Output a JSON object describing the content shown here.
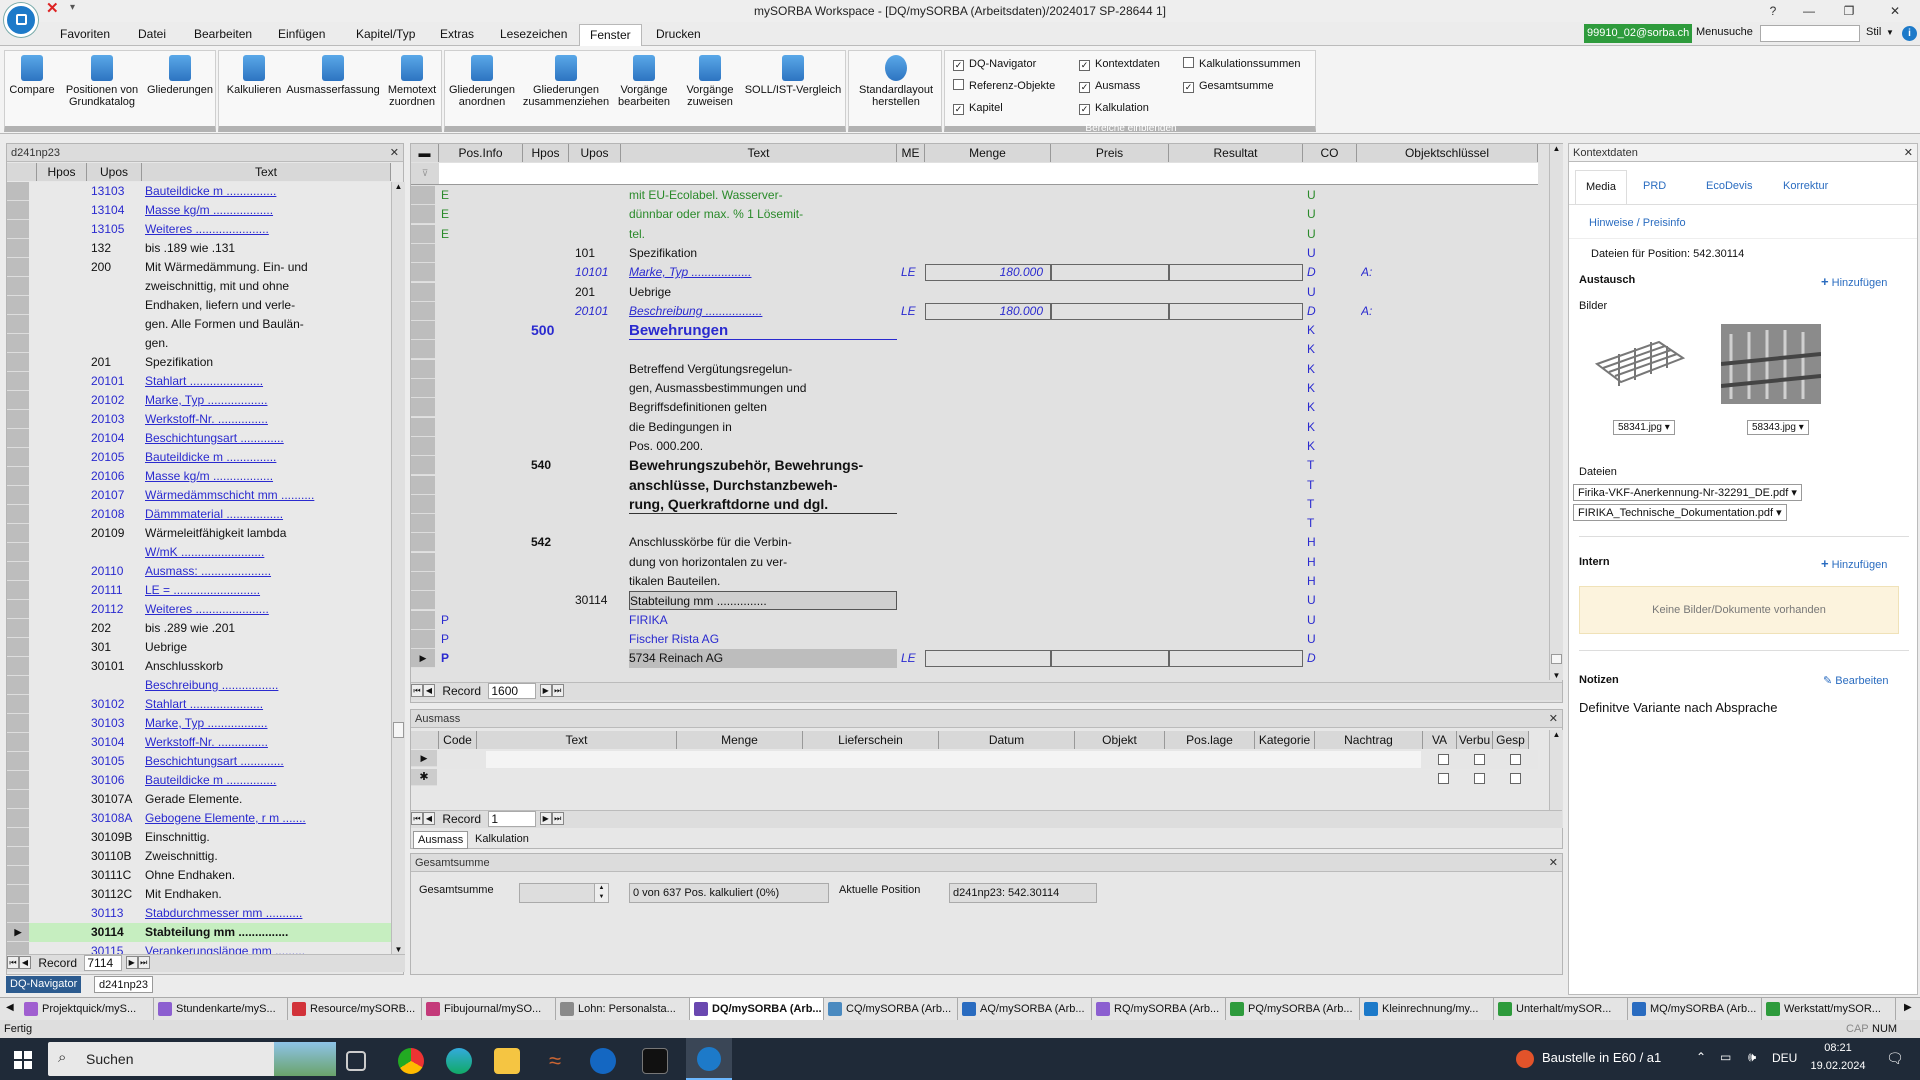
{
  "title": "mySORBA Workspace - [DQ/mySORBA (Arbeitsdaten)/2024017 SP-28644 1]",
  "titlebar_buttons": {
    "help": "?",
    "minimize": "—",
    "restore": "❐",
    "close": "✕"
  },
  "menu": [
    "Favoriten",
    "Datei",
    "Bearbeiten",
    "Einfügen",
    "Kapitel/Typ",
    "Extras",
    "Lesezeichen",
    "Fenster",
    "Drucken"
  ],
  "menu_active": "Fenster",
  "user": "99910_02@sorba.ch",
  "menusuche_label": "Menusuche",
  "stil_label": "Stil",
  "ribbon": {
    "group1": [
      {
        "l1": "Compare",
        "l2": ""
      },
      {
        "l1": "Positionen von",
        "l2": "Grundkatalog"
      },
      {
        "l1": "Gliederungen",
        "l2": ""
      }
    ],
    "group2": [
      {
        "l1": "Kalkulieren",
        "l2": ""
      },
      {
        "l1": "Ausmasserfassung",
        "l2": ""
      },
      {
        "l1": "Memotext",
        "l2": "zuordnen"
      }
    ],
    "group3": [
      {
        "l1": "Gliederungen",
        "l2": "anordnen"
      },
      {
        "l1": "Gliederungen",
        "l2": "zusammenziehen"
      },
      {
        "l1": "Vorgänge",
        "l2": "bearbeiten"
      },
      {
        "l1": "Vorgänge",
        "l2": "zuweisen"
      },
      {
        "l1": "SOLL/IST-Vergleich",
        "l2": ""
      }
    ],
    "group4": [
      {
        "l1": "Standardlayout",
        "l2": "herstellen"
      }
    ],
    "checks": [
      {
        "label": "DQ-Navigator",
        "checked": true
      },
      {
        "label": "Referenz-Objekte",
        "checked": false
      },
      {
        "label": "Kapitel",
        "checked": true
      },
      {
        "label": "Kontextdaten",
        "checked": true
      },
      {
        "label": "Ausmass",
        "checked": true
      },
      {
        "label": "Kalkulation",
        "checked": true
      },
      {
        "label": "Kalkulationssummen",
        "checked": false
      },
      {
        "label": "Gesamtsumme",
        "checked": true
      }
    ],
    "bereiche_label": "Bereiche einblenden"
  },
  "nav": {
    "title": "d241np23",
    "headers": [
      "Hpos",
      "Upos",
      "Text"
    ],
    "rows": [
      [
        "",
        "13103",
        "Bauteildicke m ...............",
        "blue"
      ],
      [
        "",
        "13104",
        "Masse kg/m ..................",
        "blue"
      ],
      [
        "",
        "13105",
        "Weiteres ......................",
        "blue"
      ],
      [
        "",
        "132",
        "bis .189 wie .131",
        ""
      ],
      [
        "",
        "200",
        "Mit Wärmedämmung. Ein- und",
        ""
      ],
      [
        "",
        "",
        "zweischnittig, mit und ohne",
        ""
      ],
      [
        "",
        "",
        "Endhaken, liefern und verle-",
        ""
      ],
      [
        "",
        "",
        "gen. Alle Formen und Baulän-",
        ""
      ],
      [
        "",
        "",
        "gen.",
        ""
      ],
      [
        "",
        "201",
        "Spezifikation",
        ""
      ],
      [
        "",
        "20101",
        "Stahlart ......................",
        "blue"
      ],
      [
        "",
        "20102",
        "Marke, Typ ..................",
        "blue"
      ],
      [
        "",
        "20103",
        "Werkstoff-Nr. ...............",
        "blue"
      ],
      [
        "",
        "20104",
        "Beschichtungsart .............",
        "blue"
      ],
      [
        "",
        "20105",
        "Bauteildicke m ...............",
        "blue"
      ],
      [
        "",
        "20106",
        "Masse kg/m ..................",
        "blue"
      ],
      [
        "",
        "20107",
        "Wärmedämmschicht mm ..........",
        "blue"
      ],
      [
        "",
        "20108",
        "Dämmmaterial .................",
        "blue"
      ],
      [
        "",
        "20109",
        "Wärmeleitfähigkeit lambda",
        ""
      ],
      [
        "",
        "",
        "W/mK .........................",
        "blue"
      ],
      [
        "",
        "20110",
        "Ausmass: .....................",
        "blue"
      ],
      [
        "",
        "20111",
        "LE = ..........................",
        "blue"
      ],
      [
        "",
        "20112",
        "Weiteres ......................",
        "blue"
      ],
      [
        "",
        "202",
        "bis .289 wie .201",
        ""
      ],
      [
        "",
        "301",
        "Uebrige",
        ""
      ],
      [
        "",
        "30101",
        "Anschlusskorb",
        ""
      ],
      [
        "",
        "",
        "Beschreibung .................",
        "blue"
      ],
      [
        "",
        "30102",
        "Stahlart ......................",
        "blue"
      ],
      [
        "",
        "30103",
        "Marke, Typ ..................",
        "blue"
      ],
      [
        "",
        "30104",
        "Werkstoff-Nr. ...............",
        "blue"
      ],
      [
        "",
        "30105",
        "Beschichtungsart .............",
        "blue"
      ],
      [
        "",
        "30106",
        "Bauteildicke m ...............",
        "blue"
      ],
      [
        "",
        "30107A",
        "Gerade Elemente.",
        ""
      ],
      [
        "",
        "30108A",
        "Gebogene Elemente, r m .......",
        "blue"
      ],
      [
        "",
        "30109B",
        "Einschnittig.",
        ""
      ],
      [
        "",
        "30110B",
        "Zweischnittig.",
        ""
      ],
      [
        "",
        "30111C",
        "Ohne Endhaken.",
        ""
      ],
      [
        "",
        "30112C",
        "Mit Endhaken.",
        ""
      ],
      [
        "",
        "30113",
        "Stabdurchmesser mm ...........",
        "blue"
      ],
      [
        "",
        "30114",
        "Stabteilung mm ...............",
        "sel"
      ],
      [
        "",
        "30115",
        "Verankerungslänge mm .........",
        "blue"
      ]
    ],
    "record_label": "Record",
    "record_value": "7114",
    "tabs": [
      "DQ-Navigator",
      "d241np23"
    ]
  },
  "grid": {
    "headers": [
      "Pos.Info",
      "Hpos",
      "Upos",
      "Text",
      "ME",
      "Menge",
      "Preis",
      "Resultat",
      "CO",
      "Objektschlüssel"
    ],
    "rows": [
      {
        "info": "E",
        "hpos": "",
        "upos": "",
        "text": "mit EU-Ecolabel. Wasserver-",
        "me": "",
        "menge": "",
        "co": "U",
        "obj": "",
        "style": "green"
      },
      {
        "info": "E",
        "hpos": "",
        "upos": "",
        "text": "dünnbar oder max. % 1 Lösemit-",
        "me": "",
        "menge": "",
        "co": "U",
        "obj": "",
        "style": "green"
      },
      {
        "info": "E",
        "hpos": "",
        "upos": "",
        "text": "tel.",
        "me": "",
        "menge": "",
        "co": "U",
        "obj": "",
        "style": "green"
      },
      {
        "info": "",
        "hpos": "",
        "upos": "101",
        "text": "Spezifikation",
        "me": "",
        "menge": "",
        "co": "U",
        "obj": "",
        "style": ""
      },
      {
        "info": "",
        "hpos": "",
        "upos": "10101",
        "text": "Marke, Typ ..................",
        "me": "LE",
        "menge": "180.000",
        "co": "D",
        "obj": "A:",
        "style": "italic"
      },
      {
        "info": "",
        "hpos": "",
        "upos": "201",
        "text": "Uebrige",
        "me": "",
        "menge": "",
        "co": "U",
        "obj": "",
        "style": ""
      },
      {
        "info": "",
        "hpos": "",
        "upos": "20101",
        "text": "Beschreibung .................",
        "me": "LE",
        "menge": "180.000",
        "co": "D",
        "obj": "A:",
        "style": "italic"
      },
      {
        "info": "",
        "hpos": "500",
        "hpos_style": "big",
        "upos": "",
        "text": "Bewehrungen",
        "me": "",
        "menge": "",
        "co": "K",
        "obj": "",
        "style": "bigblue"
      },
      {
        "info": "",
        "hpos": "",
        "upos": "",
        "text": "",
        "me": "",
        "menge": "",
        "co": "K",
        "obj": "",
        "style": ""
      },
      {
        "info": "",
        "hpos": "",
        "upos": "",
        "text": "Betreffend Vergütungsregelun-",
        "me": "",
        "menge": "",
        "co": "K",
        "obj": "",
        "style": ""
      },
      {
        "info": "",
        "hpos": "",
        "upos": "",
        "text": "gen, Ausmassbestimmungen und",
        "me": "",
        "menge": "",
        "co": "K",
        "obj": "",
        "style": ""
      },
      {
        "info": "",
        "hpos": "",
        "upos": "",
        "text": "Begriffsdefinitionen gelten",
        "me": "",
        "menge": "",
        "co": "K",
        "obj": "",
        "style": ""
      },
      {
        "info": "",
        "hpos": "",
        "upos": "",
        "text": "die Bedingungen in",
        "me": "",
        "menge": "",
        "co": "K",
        "obj": "",
        "style": ""
      },
      {
        "info": "",
        "hpos": "",
        "upos": "",
        "text": "Pos. 000.200.",
        "me": "",
        "menge": "",
        "co": "K",
        "obj": "",
        "style": ""
      },
      {
        "info": "",
        "hpos": "540",
        "upos": "",
        "text": "Bewehrungszubehör, Bewehrungs-",
        "me": "",
        "menge": "",
        "co": "T",
        "obj": "",
        "style": "bold"
      },
      {
        "info": "",
        "hpos": "",
        "upos": "",
        "text": "anschlüsse, Durchstanzbeweh-",
        "me": "",
        "menge": "",
        "co": "T",
        "obj": "",
        "style": "bold"
      },
      {
        "info": "",
        "hpos": "",
        "upos": "",
        "text": "rung, Querkraftdorne und dgl.",
        "me": "",
        "menge": "",
        "co": "T",
        "obj": "",
        "style": "bold"
      },
      {
        "info": "",
        "hpos": "",
        "upos": "",
        "text": "",
        "me": "",
        "menge": "",
        "co": "T",
        "obj": "",
        "style": ""
      },
      {
        "info": "",
        "hpos": "542",
        "upos": "",
        "text": "Anschlusskörbe für die Verbin-",
        "me": "",
        "menge": "",
        "co": "H",
        "obj": "",
        "style": ""
      },
      {
        "info": "",
        "hpos": "",
        "upos": "",
        "text": "dung von horizontalen zu ver-",
        "me": "",
        "menge": "",
        "co": "H",
        "obj": "",
        "style": ""
      },
      {
        "info": "",
        "hpos": "",
        "upos": "",
        "text": "tikalen Bauteilen.",
        "me": "",
        "menge": "",
        "co": "H",
        "obj": "",
        "style": ""
      },
      {
        "info": "",
        "hpos": "",
        "upos": "30114",
        "text": "Stabteilung mm ...............",
        "me": "",
        "menge": "",
        "co": "U",
        "obj": "",
        "style": "boxed"
      },
      {
        "info": "P",
        "hpos": "",
        "upos": "",
        "text": "FIRIKA",
        "me": "",
        "menge": "",
        "co": "U",
        "obj": "",
        "style": "blue"
      },
      {
        "info": "P",
        "hpos": "",
        "upos": "",
        "text": "Fischer Rista AG",
        "me": "",
        "menge": "",
        "co": "U",
        "obj": "",
        "style": "blue"
      },
      {
        "info": "P",
        "hpos": "",
        "upos": "",
        "text": "5734 Reinach AG",
        "me": "LE",
        "menge": "",
        "co": "D",
        "obj": "",
        "style": "current"
      }
    ],
    "record_label": "Record",
    "record_value": "1600"
  },
  "ausmass": {
    "title": "Ausmass",
    "headers": [
      "Code",
      "Text",
      "Menge",
      "Lieferschein",
      "Datum",
      "Objekt",
      "Pos.lage",
      "Kategorie",
      "Nachtrag",
      "VA",
      "Verbu",
      "Gesp"
    ],
    "record_label": "Record",
    "record_value": "1",
    "tabs": [
      "Ausmass",
      "Kalkulation"
    ]
  },
  "gesamt": {
    "title": "Gesamtsumme",
    "label": "Gesamtsumme",
    "status": "0 von 637 Pos. kalkuliert (0%)",
    "aktuelle_label": "Aktuelle Position",
    "aktuelle_value": "d241np23: 542.30114"
  },
  "kontext": {
    "title": "Kontextdaten",
    "tabs": [
      "Media",
      "PRD",
      "EcoDevis",
      "Korrektur"
    ],
    "link": "Hinweise / Preisinfo",
    "dateien_fuer": "Dateien für Position: 542.30114",
    "austausch": "Austausch",
    "hinzufuegen": "Hinzufügen",
    "bilder": "Bilder",
    "images": [
      "58341.jpg",
      "58343.jpg"
    ],
    "dateien": "Dateien",
    "files": [
      "Firika-VKF-Anerkennung-Nr-32291_DE.pdf",
      "FIRIKA_Technische_Dokumentation.pdf"
    ],
    "intern": "Intern",
    "keine": "Keine Bilder/Dokumente vorhanden",
    "notizen": "Notizen",
    "bearbeiten": "Bearbeiten",
    "notiz": "Definitve Variante nach Absprache"
  },
  "windowtabs": [
    "Projektquick/myS...",
    "Stundenkarte/myS...",
    "Resource/mySORB...",
    "Fibujournal/mySO...",
    "Lohn: Personalsta...",
    "DQ/mySORBA (Arb...",
    "CQ/mySORBA (Arb...",
    "AQ/mySORBA (Arb...",
    "RQ/mySORBA (Arb...",
    "PQ/mySORBA (Arb...",
    "Kleinrechnung/my...",
    "Unterhalt/mySOR...",
    "MQ/mySORBA (Arb...",
    "Werkstatt/mySOR..."
  ],
  "windowtab_active": 5,
  "status": "Fertig",
  "status_right": [
    "CAP",
    "NUM"
  ],
  "taskbar": {
    "search": "Suchen",
    "notification": "Baustelle in E60 / a1",
    "lang": "DEU",
    "time": "08:21",
    "date": "19.02.2024"
  },
  "colors": {
    "accent": "#2a2acf",
    "green": "#2a8a2a",
    "selected": "#c6eec0",
    "taskbar": "#1f2a38"
  }
}
